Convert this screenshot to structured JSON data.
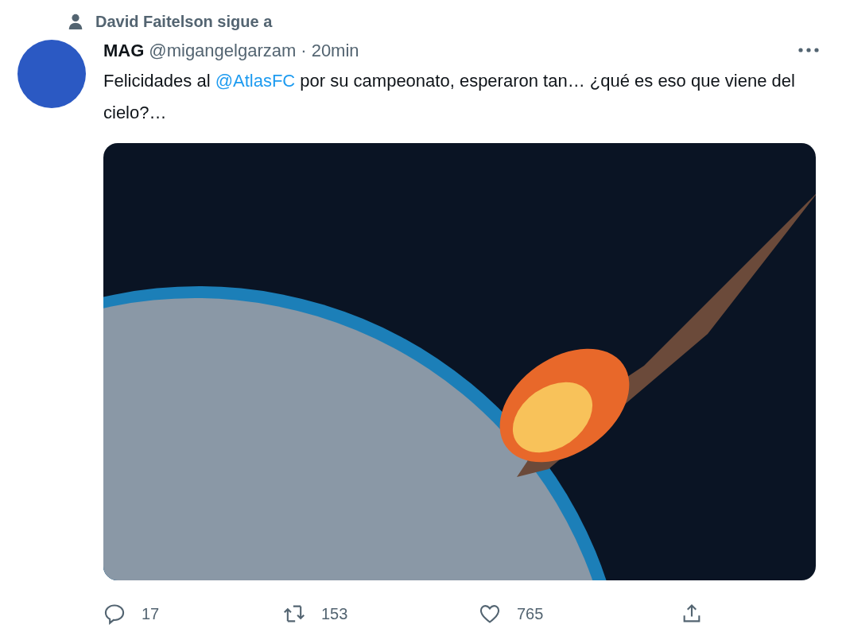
{
  "social_context": "David Faitelson sigue a",
  "tweet": {
    "display_name": "MAG",
    "handle": "@migangelgarzam",
    "separator": "·",
    "time": "20min",
    "text": [
      {
        "kind": "text",
        "value": "Felicidades al "
      },
      {
        "kind": "mention",
        "value": "@AtlasFC"
      },
      {
        "kind": "text",
        "value": " por su campeonato, esperaron tan… ¿qué es eso que viene del cielo?…"
      }
    ]
  },
  "actions": [
    {
      "kind": "reply",
      "count": "17"
    },
    {
      "kind": "retweet",
      "count": "153"
    },
    {
      "kind": "like",
      "count": "765"
    },
    {
      "kind": "share"
    }
  ]
}
